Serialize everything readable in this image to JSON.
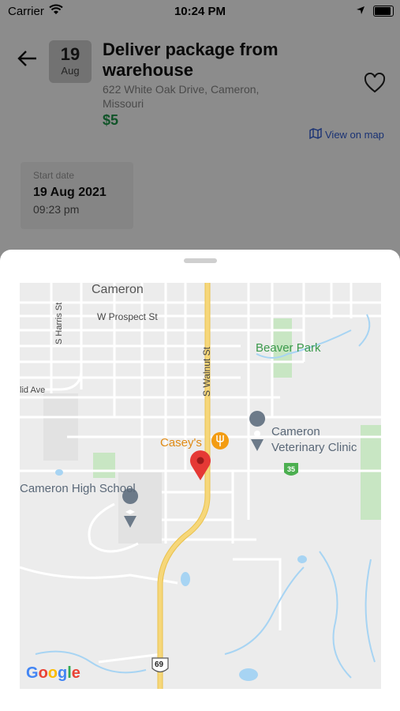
{
  "status_bar": {
    "carrier": "Carrier",
    "time": "10:24 PM"
  },
  "task": {
    "date_day": "19",
    "date_month": "Aug",
    "title": "Deliver package from warehouse",
    "address": "622 White Oak Drive, Cameron, Missouri",
    "price": "$5",
    "view_on_map": "View on map"
  },
  "start_card": {
    "label": "Start date",
    "date": "19 Aug 2021",
    "time": "09:23 pm"
  },
  "map": {
    "labels": {
      "cameron": "Cameron",
      "w_prospect": "W Prospect St",
      "s_harris": "S Harris St",
      "s_walnut": "S Walnut St",
      "beaver_park": "Beaver Park",
      "lid_ave": "lid Ave",
      "caseys": "Casey's",
      "vet_clinic_1": "Cameron",
      "vet_clinic_2": "Veterinary Clinic",
      "high_school": "Cameron High School",
      "route_35": "35",
      "route_69": "69"
    },
    "attribution": "Google",
    "colors": {
      "background": "#ececec",
      "road": "#ffffff",
      "highway": "#f6d77a",
      "park": "#c8e6c3",
      "water": "#a7d4f3",
      "pin": "#e53935"
    }
  }
}
